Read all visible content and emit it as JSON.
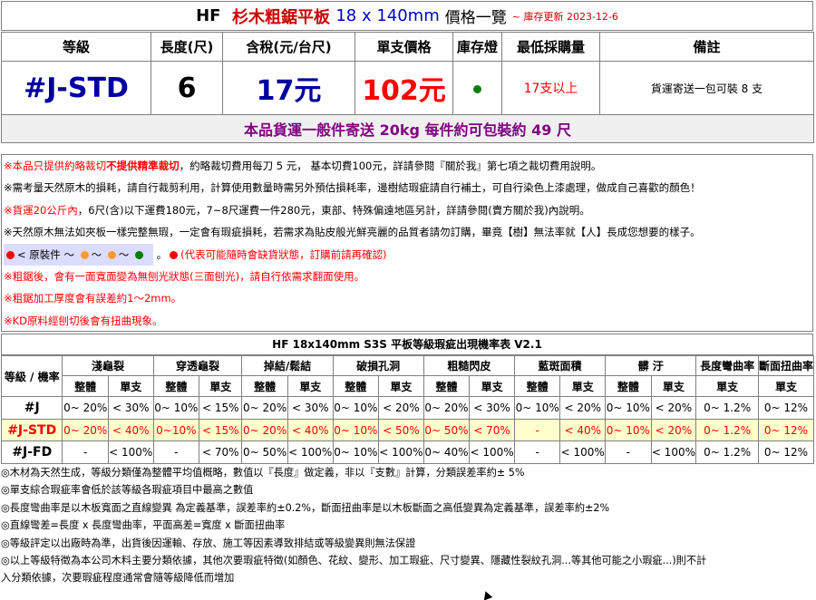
{
  "title": {
    "brand": "HF",
    "product": "杉木粗鋸平板",
    "size": "18 x 140mm",
    "suffix": "價格一覽",
    "updated": "~ 庫存更新 2023-12-6"
  },
  "main": {
    "headers": [
      "等級",
      "長度(尺)",
      "含稅(元/台尺)",
      "單支價格",
      "庫存燈",
      "最低採購量",
      "備註"
    ],
    "grade": "#J-STD",
    "length": "6",
    "price_per_unit": "17元",
    "unit_price": "102元",
    "stock_light_color": "#008000",
    "moq": "17支以上",
    "remark": "貨運寄送一包可裝 8 支",
    "shipping": "本品貨運一般件寄送 20kg 每件約可包裝約 49 尺"
  },
  "notes": {
    "l1a": "※本品只提供約略裁切",
    "l1b": "不提供精準裁切",
    "l1c": "，約略裁切費用每刀 5 元， 基本切費100元，詳請參閱『關於我』第七項之裁切費用說明。",
    "l2": "※需考量天然原木的損耗，請自行裁剪利用，計算使用數量時需另外預估損耗率，邊樹結瑕疵請自行補土，可自行染色上漆處理，做成自己喜歡的顏色！",
    "l3a": "※貨運20公斤內",
    "l3b": "，6尺(含)以下運費180元，7~8尺運費一件280元，東部、特殊偏遠地區另計，詳請參閱(賣方關於我)內說明。",
    "l4": "※天然原木無法如夾板一樣完整無瑕，一定會有瑕疵損耗，若需求為貼皮般光鮮亮麗的品質者請勿訂購，畢竟【樹】無法率就【人】長成您想要的樣子。",
    "legend_label": "< 原裝件 ～",
    "legend_tilde": "～",
    "legend_note": "(代表可能隨時會缺貨狀態，訂購前請再確認)",
    "legend_colors": [
      "#ff0000",
      "#ff9933",
      "#ff9933",
      "#008000"
    ],
    "l6": "※粗鋸後，會有一面寬面變為無刨光狀態(三面刨光)，請自行依需求翻面使用。",
    "l7": "※粗鋸加工厚度會有誤差約1～2mm。",
    "l8": "※KD原料經刨切後會有扭曲現象。"
  },
  "grade_table": {
    "title": "HF 18x140mm S3S 平板等級瑕疵出現機率表 V2.1",
    "corner": "等級 / 機率",
    "groups": [
      "淺龜裂",
      "穿透龜裂",
      "掉結/鬆結",
      "破損孔洞",
      "粗糙閃皮",
      "藍斑面積",
      "髒 汙",
      "長度彎曲率",
      "斷面扭曲率"
    ],
    "sub_whole": "整體",
    "sub_single": "單支",
    "rows": [
      {
        "name": "#J",
        "cells": [
          "0~ 20%",
          "< 30%",
          "0~ 10%",
          "< 15%",
          "0~ 20%",
          "< 30%",
          "0~ 10%",
          "< 20%",
          "0~ 20%",
          "< 30%",
          "0~ 10%",
          "< 20%",
          "0~ 10%",
          "< 20%",
          "0~ 1.2%",
          "0~ 12%"
        ]
      },
      {
        "name": "#J-STD",
        "cells": [
          "0~ 20%",
          "< 40%",
          "0~10%",
          "< 15%",
          "0~ 20%",
          "< 40%",
          "0~ 10%",
          "< 50%",
          "0~ 50%",
          "< 70%",
          "-",
          "< 40%",
          "0~ 10%",
          "< 20%",
          "0~ 1.2%",
          "0~ 12%"
        ]
      },
      {
        "name": "#J-FD",
        "cells": [
          "-",
          "< 100%",
          "-",
          "< 70%",
          "0~ 50%",
          "< 100%",
          "0~ 10%",
          "< 100%",
          "0~ 40%",
          "< 100%",
          "-",
          "< 100%",
          "-",
          "< 100%",
          "0~ 1.2%",
          "0~ 12%"
        ]
      }
    ]
  },
  "footnotes": [
    "◎木材為天然生成，等級分類僅為整體平均值概略，數值以『長度』做定義，非以『支數』計算，分類誤差率約± 5%",
    "◎單支綜合瑕疵率會低於該等級各瑕疵項目中最高之數值",
    "◎長度彎曲率是以木板寬面之直線變異 為定義基準，誤差率約±0.2%，斷面扭曲率是以木板斷面之高低變異為定義基準，誤差率約±2%",
    "◎直線彎差=長度 x 長度彎曲率，平面高差=寬度 x 斷面扭曲率",
    "◎等級評定以出廠時為準，出貨後因運輸、存放、施工等因素導致排結或等級變異則無法保證",
    "◎以上等級特徵為本公司木料主要分類依據，其他次要瑕疵特徵(如顏色、花紋、變形、加工瑕疵、尺寸變異、隱藏性裂紋孔洞...等其他可能之小瑕疵...)則不計",
    "入分類依據，次要瑕疵程度通常會隨等級降低而增加"
  ]
}
